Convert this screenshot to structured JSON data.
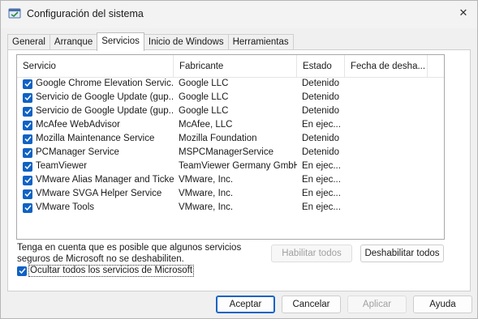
{
  "window": {
    "title": "Configuración del sistema",
    "icon": "msconfig-icon",
    "close_glyph": "✕"
  },
  "tabs": [
    {
      "label": "General"
    },
    {
      "label": "Arranque"
    },
    {
      "label": "Servicios"
    },
    {
      "label": "Inicio de Windows"
    },
    {
      "label": "Herramientas"
    }
  ],
  "active_tab": "Servicios",
  "table": {
    "columns": [
      "Servicio",
      "Fabricante",
      "Estado",
      "Fecha de desha..."
    ],
    "rows": [
      {
        "checked": true,
        "service": "Google Chrome Elevation Servic...",
        "vendor": "Google LLC",
        "status": "Detenido"
      },
      {
        "checked": true,
        "service": "Servicio de Google Update (gup...",
        "vendor": "Google LLC",
        "status": "Detenido"
      },
      {
        "checked": true,
        "service": "Servicio de Google Update (gup...",
        "vendor": "Google LLC",
        "status": "Detenido"
      },
      {
        "checked": true,
        "service": "McAfee WebAdvisor",
        "vendor": "McAfee, LLC",
        "status": "En ejec..."
      },
      {
        "checked": true,
        "service": "Mozilla Maintenance Service",
        "vendor": "Mozilla Foundation",
        "status": "Detenido"
      },
      {
        "checked": true,
        "service": "PCManager Service",
        "vendor": "MSPCManagerService",
        "status": "Detenido"
      },
      {
        "checked": true,
        "service": "TeamViewer",
        "vendor": "TeamViewer Germany GmbH",
        "status": "En ejec..."
      },
      {
        "checked": true,
        "service": "VMware Alias Manager and Ticke...",
        "vendor": "VMware, Inc.",
        "status": "En ejec..."
      },
      {
        "checked": true,
        "service": "VMware SVGA Helper Service",
        "vendor": "VMware, Inc.",
        "status": "En ejec..."
      },
      {
        "checked": true,
        "service": "VMware Tools",
        "vendor": "VMware, Inc.",
        "status": "En ejec..."
      }
    ]
  },
  "note": {
    "line1": "Tenga en cuenta que es posible que algunos servicios",
    "line2": "seguros de Microsoft no se deshabiliten."
  },
  "buttons": {
    "enable_all": "Habilitar todos",
    "disable_all": "Deshabilitar todos",
    "ok": "Aceptar",
    "cancel": "Cancelar",
    "apply": "Aplicar",
    "help": "Ayuda"
  },
  "hide_microsoft": {
    "checked": true,
    "label": "Ocultar todos los servicios de Microsoft"
  },
  "colors": {
    "accent": "#0f62c4"
  }
}
